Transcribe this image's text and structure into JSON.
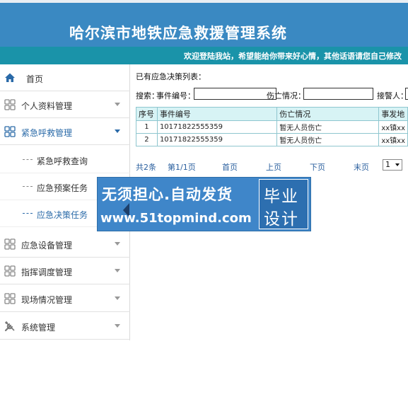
{
  "header": {
    "title": "哈尔滨市地铁应急救援管理系统",
    "welcome": "欢迎登陆我站，希望能给你带来好心情，其他话语请您自己修改"
  },
  "sidebar": {
    "items": [
      {
        "label": "首页",
        "icon": "home-icon"
      },
      {
        "label": "个人资料管理",
        "icon": "grid-icon"
      },
      {
        "label": "紧急呼救管理",
        "icon": "grid-icon"
      },
      {
        "label": "应急设备管理",
        "icon": "grid-icon"
      },
      {
        "label": "指挥调度管理",
        "icon": "grid-icon"
      },
      {
        "label": "现场情况管理",
        "icon": "grid-icon"
      },
      {
        "label": "系统管理",
        "icon": "tools-icon"
      }
    ],
    "sub_items": [
      {
        "label": "紧急呼救查询"
      },
      {
        "label": "应急预案任务"
      },
      {
        "label": "应急决策任务"
      }
    ]
  },
  "main": {
    "list_title": "已有应急决策列表：",
    "search": {
      "label": "搜索：",
      "field1_label": "事件编号：",
      "field1_value": "",
      "field2_label": "伤亡情况：",
      "field2_value": "",
      "field3_label": "接警人：",
      "field3_value": ""
    },
    "table": {
      "columns": [
        "序号",
        "事件编号",
        "伤亡情况",
        "事发地"
      ],
      "rows": [
        [
          "1",
          "10171822555359",
          "暂无人员伤亡",
          "xx镇xx"
        ],
        [
          "2",
          "10171822555359",
          "暂无人员伤亡",
          "xx镇xx"
        ]
      ]
    },
    "pager": {
      "total": "共2条",
      "page_info": "第1/1页",
      "first": "首页",
      "prev": "上页",
      "next": "下页",
      "last": "末页",
      "page_select": "1"
    }
  },
  "overlay": {
    "line1": "无须担心.自动发货",
    "line2": "www.51topmind.com",
    "badge_line1": "毕业",
    "badge_line2": "设计"
  },
  "colors": {
    "header_bg": "#3a89c2",
    "welcome_bg": "#1a93a9",
    "accent": "#2a6aa8",
    "table_header_bg": "#d7f3f5",
    "banner_bg": "#3f86c9"
  }
}
